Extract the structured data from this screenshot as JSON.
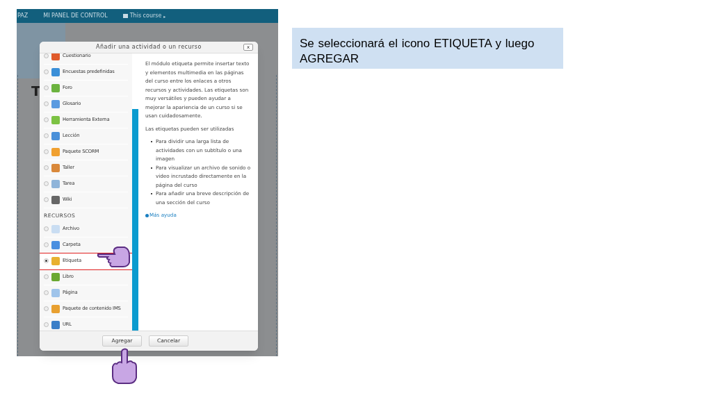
{
  "navbar": {
    "items": [
      {
        "label": "PAZ"
      },
      {
        "label": "MI PANEL DE CONTROL"
      },
      {
        "label": "This course",
        "caret": "▸"
      }
    ]
  },
  "page_heading_fragment": "T",
  "dialog": {
    "title": "Añadir una actividad o un recurso",
    "close": "x",
    "activities": [
      {
        "label": "Cuestionario",
        "selected": false
      },
      {
        "label": "Encuestas predefinidas",
        "selected": false
      },
      {
        "label": "Foro",
        "selected": false
      },
      {
        "label": "Glosario",
        "selected": false
      },
      {
        "label": "Herramienta Externa",
        "selected": false
      },
      {
        "label": "Lección",
        "selected": false
      },
      {
        "label": "Paquete SCORM",
        "selected": false
      },
      {
        "label": "Taller",
        "selected": false
      },
      {
        "label": "Tarea",
        "selected": false
      },
      {
        "label": "Wiki",
        "selected": false
      }
    ],
    "section_heading": "RECURSOS",
    "resources": [
      {
        "label": "Archivo",
        "selected": false,
        "highlighted": false
      },
      {
        "label": "Carpeta",
        "selected": false,
        "highlighted": false
      },
      {
        "label": "Etiqueta",
        "selected": true,
        "highlighted": true
      },
      {
        "label": "Libro",
        "selected": false,
        "highlighted": false
      },
      {
        "label": "Página",
        "selected": false,
        "highlighted": false
      },
      {
        "label": "Paquete de contenido IMS",
        "selected": false,
        "highlighted": false
      },
      {
        "label": "URL",
        "selected": false,
        "highlighted": false
      }
    ],
    "description": {
      "paragraphs": [
        "El módulo etiqueta permite insertar texto y elementos multimedia en las páginas del curso entre los enlaces a otros recursos y actividades. Las etiquetas son muy versátiles y pueden ayudar a mejorar la apariencia de un curso si se usan cuidadosamente.",
        "Las etiquetas pueden ser utilizadas"
      ],
      "bullets": [
        "Para dividir una larga lista de actividades con un subtítulo o una imagen",
        "Para visualizar un archivo de sonido o video incrustado directamente en la página del curso",
        "Para añadir una breve descripción de una sección del curso"
      ],
      "help_link": "Más ayuda"
    },
    "buttons": [
      "Agregar",
      "Cancelar"
    ]
  },
  "callout": {
    "text": "Se seleccionará el icono ETIQUETA y luego AGREGAR"
  }
}
